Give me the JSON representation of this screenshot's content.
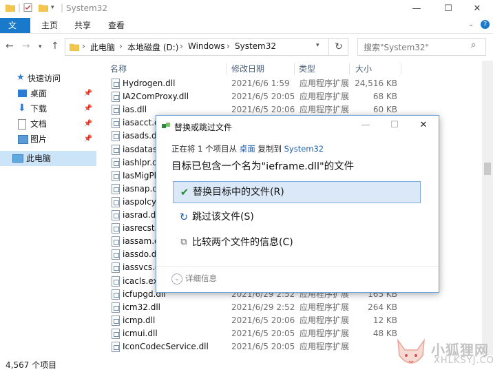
{
  "window": {
    "title": "System32",
    "controls": {
      "minimize": "—",
      "maximize": "☐",
      "close": "✕"
    }
  },
  "ribbon": {
    "tabs": [
      "文件",
      "主页",
      "共享",
      "查看"
    ],
    "help": "?"
  },
  "address": {
    "path": [
      "此电脑",
      "本地磁盘 (D:)",
      "Windows",
      "System32"
    ],
    "search_placeholder": "搜索\"System32\""
  },
  "sidebar": {
    "items": [
      {
        "label": "快速访问",
        "icon": "star-icon",
        "pinned": false
      },
      {
        "label": "桌面",
        "icon": "desktop-icon",
        "pinned": true
      },
      {
        "label": "下载",
        "icon": "download-icon",
        "pinned": true
      },
      {
        "label": "文档",
        "icon": "document-icon",
        "pinned": true
      },
      {
        "label": "图片",
        "icon": "picture-icon",
        "pinned": true
      },
      {
        "label": "此电脑",
        "icon": "computer-icon",
        "pinned": false,
        "selected": true
      }
    ]
  },
  "list": {
    "columns": [
      "名称",
      "修改日期",
      "类型",
      "大小"
    ],
    "rows": [
      {
        "name": "Hydrogen.dll",
        "date": "2021/6/6 1:59",
        "type": "应用程序扩展",
        "size": "24,516 KB"
      },
      {
        "name": "IA2ComProxy.dll",
        "date": "2021/6/5 20:05",
        "type": "应用程序扩展",
        "size": "68 KB"
      },
      {
        "name": "ias.dll",
        "date": "2021/6/5 20:06",
        "type": "应用程序扩展",
        "size": "60 KB"
      },
      {
        "name": "iasacct.dll",
        "date": "",
        "type": "",
        "size": ""
      },
      {
        "name": "iasads.dll",
        "date": "",
        "type": "",
        "size": ""
      },
      {
        "name": "iasdatast",
        "date": "",
        "type": "",
        "size": ""
      },
      {
        "name": "iashlpr.dl",
        "date": "",
        "type": "",
        "size": ""
      },
      {
        "name": "IasMigPl",
        "date": "",
        "type": "",
        "size": ""
      },
      {
        "name": "iasnap.dl",
        "date": "",
        "type": "",
        "size": ""
      },
      {
        "name": "iaspolcy.",
        "date": "",
        "type": "",
        "size": ""
      },
      {
        "name": "iasrad.dll",
        "date": "",
        "type": "",
        "size": ""
      },
      {
        "name": "iasrecst.c",
        "date": "",
        "type": "",
        "size": ""
      },
      {
        "name": "iassam.d",
        "date": "",
        "type": "",
        "size": ""
      },
      {
        "name": "iassdo.dl",
        "date": "",
        "type": "",
        "size": ""
      },
      {
        "name": "iassvcs.d",
        "date": "",
        "type": "",
        "size": ""
      },
      {
        "name": "icacls.exe",
        "date": "",
        "type": "",
        "size": ""
      },
      {
        "name": "icfupgd.dll",
        "date": "2021/6/29 2:52",
        "type": "应用程序扩展",
        "size": "165 KB"
      },
      {
        "name": "icm32.dll",
        "date": "2021/6/29 2:52",
        "type": "应用程序扩展",
        "size": "264 KB"
      },
      {
        "name": "icmp.dll",
        "date": "2021/6/5 20:06",
        "type": "应用程序扩展",
        "size": "12 KB"
      },
      {
        "name": "icmui.dll",
        "date": "2021/6/5 20:05",
        "type": "应用程序扩展",
        "size": "48 KB"
      },
      {
        "name": "IconCodecService.dll",
        "date": "2021/6/5 20:05",
        "type": "应用程序扩展",
        "size": ""
      }
    ]
  },
  "status": {
    "count": "4,567 个项目"
  },
  "dialog": {
    "title": "替换或跳过文件",
    "line1_prefix": "正在将 1 个项目从 ",
    "source": "桌面",
    "line1_mid": " 复制到 ",
    "dest": "System32",
    "line2": "目标已包含一个名为\"ieframe.dll\"的文件",
    "options": [
      {
        "label": "替换目标中的文件(R)",
        "icon": "check-icon"
      },
      {
        "label": "跳过该文件(S)",
        "icon": "skip-icon"
      },
      {
        "label": "比较两个文件的信息(C)",
        "icon": "compare-icon"
      }
    ],
    "more": "详细信息"
  },
  "watermark": {
    "cn": "小狐狸网",
    "en": "XHLKSYJ.COM"
  }
}
